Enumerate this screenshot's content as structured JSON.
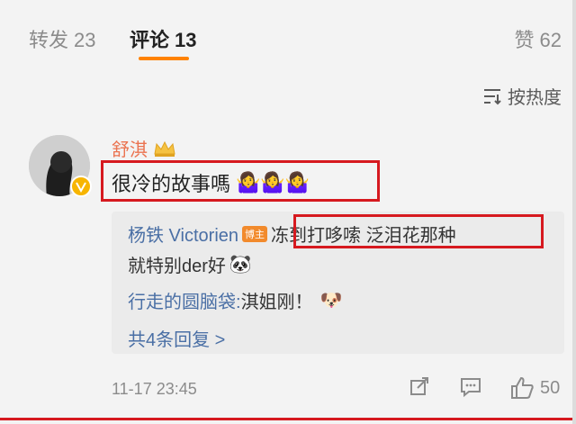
{
  "tabs": {
    "reposts": {
      "label": "转发",
      "count": "23"
    },
    "comments": {
      "label": "评论",
      "count": "13"
    },
    "likes": {
      "label": "赞",
      "count": "62"
    }
  },
  "sort": {
    "label": "按热度"
  },
  "comment": {
    "author": "舒淇",
    "text": "很冷的故事嗎",
    "emoji": "🤷‍♀️🤷‍♀️🤷‍♀️",
    "time": "11-17 23:45",
    "like_count": "50"
  },
  "replies": [
    {
      "author": "杨铁 Victorien",
      "badge": "博主",
      "text_part1": "冻到打哆嗦 泛泪花那种",
      "text_part2": "就特别der好",
      "emoji": "🐼"
    },
    {
      "author": "行走的圆脑袋:",
      "text": " 淇姐刚！",
      "emoji": "🐶"
    }
  ],
  "more_replies": "共4条回复 >",
  "colors": {
    "accent": "#ff8200",
    "highlight_box": "#d6191f",
    "link": "#4a6fa5",
    "username": "#eb7350"
  }
}
